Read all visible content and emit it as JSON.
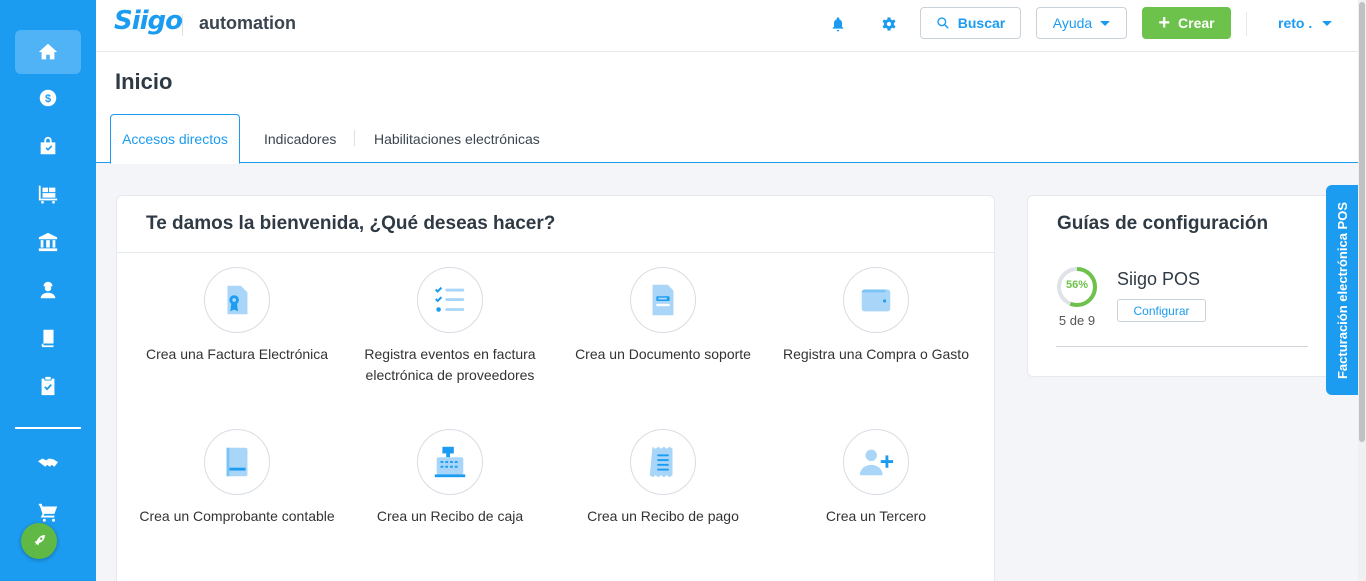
{
  "header": {
    "logo": "Siigo",
    "company": "automation",
    "search_label": "Buscar",
    "help_label": "Ayuda",
    "create_label": "Crear",
    "user_label": "reto ."
  },
  "page": {
    "title": "Inicio",
    "tabs": [
      {
        "label": "Accesos directos",
        "active": true
      },
      {
        "label": "Indicadores",
        "active": false
      },
      {
        "label": "Habilitaciones electrónicas",
        "active": false
      }
    ]
  },
  "welcome": {
    "title": "Te damos la bienvenida, ¿Qué deseas hacer?",
    "actions": [
      {
        "label": "Crea una Factura Electrónica",
        "icon": "invoice-icon"
      },
      {
        "label": "Registra eventos en factura electrónica de proveedores",
        "icon": "checklist-icon"
      },
      {
        "label": "Crea un Documento soporte",
        "icon": "document-icon"
      },
      {
        "label": "Registra una Compra o Gasto",
        "icon": "wallet-icon"
      },
      {
        "label": "Crea un Comprobante contable",
        "icon": "ledger-icon"
      },
      {
        "label": "Crea un Recibo de caja",
        "icon": "cash-register-icon"
      },
      {
        "label": "Crea un Recibo de pago",
        "icon": "receipt-icon"
      },
      {
        "label": "Crea un Tercero",
        "icon": "add-user-icon"
      }
    ]
  },
  "guides": {
    "title": "Guías de configuración",
    "items": [
      {
        "name": "Siigo POS",
        "percent_label": "56%",
        "progress": 0.56,
        "steps": "5 de 9",
        "button": "Configurar"
      }
    ]
  },
  "side_tab": {
    "label": "Facturación electrónica POS"
  },
  "colors": {
    "primary": "#1c9cf0",
    "success": "#6cc24a",
    "icon_light": "#a9d6f8"
  }
}
